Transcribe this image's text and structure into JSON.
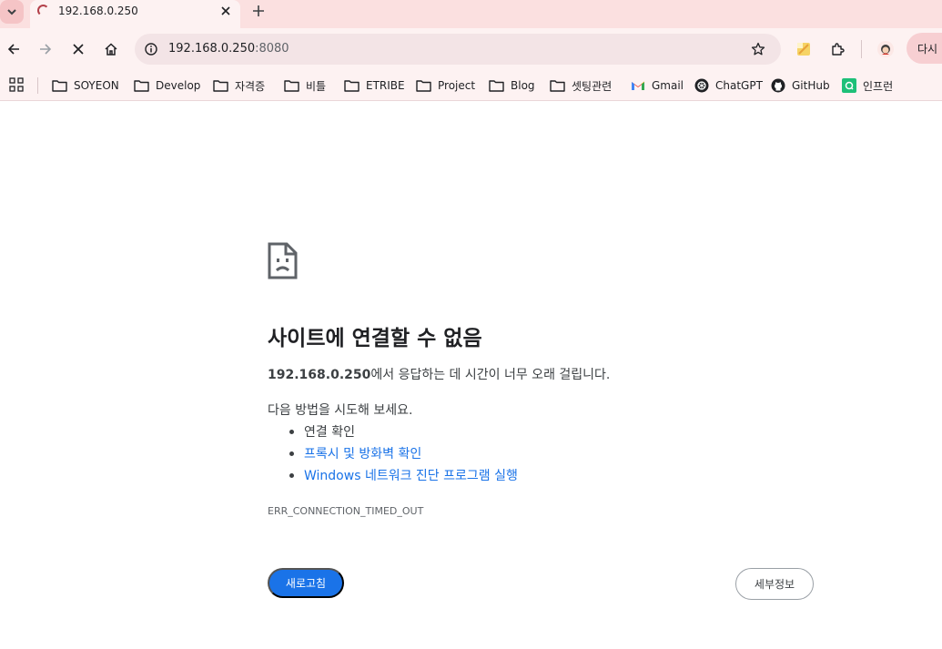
{
  "tab": {
    "title": "192.168.0.250"
  },
  "toolbar": {
    "url_host": "192.168.0.250",
    "url_port": ":8080",
    "relaunch_label": "다시"
  },
  "bookmarks": {
    "items": [
      {
        "label": "SOYEON",
        "icon": "folder-icon"
      },
      {
        "label": "Develop",
        "icon": "folder-icon"
      },
      {
        "label": "자격증",
        "icon": "folder-icon"
      },
      {
        "label": "비틀",
        "icon": "folder-icon"
      },
      {
        "label": "ETRIBE",
        "icon": "folder-icon"
      },
      {
        "label": "Project",
        "icon": "folder-icon"
      },
      {
        "label": "Blog",
        "icon": "folder-icon"
      },
      {
        "label": "셋팅관련",
        "icon": "folder-icon"
      },
      {
        "label": "Gmail",
        "icon": "gmail-icon"
      },
      {
        "label": "ChatGPT",
        "icon": "chatgpt-icon"
      },
      {
        "label": "GitHub",
        "icon": "github-icon"
      },
      {
        "label": "인프런",
        "icon": "inflearn-icon"
      }
    ]
  },
  "error": {
    "title": "사이트에 연결할 수 없음",
    "host": "192.168.0.250",
    "message_suffix": "에서 응답하는 데 시간이 너무 오래 걸립니다.",
    "try_heading": "다음 방법을 시도해 보세요.",
    "suggestions": [
      "연결 확인",
      "프록시 및 방화벽 확인",
      "Windows 네트워크 진단 프로그램 실행"
    ],
    "code": "ERR_CONNECTION_TIMED_OUT",
    "reload_label": "새로고침",
    "details_label": "세부정보"
  },
  "colors": {
    "accent": "#1a73e8",
    "tabstrip": "#fbe0e0",
    "toolbar": "#fdf2f2"
  }
}
